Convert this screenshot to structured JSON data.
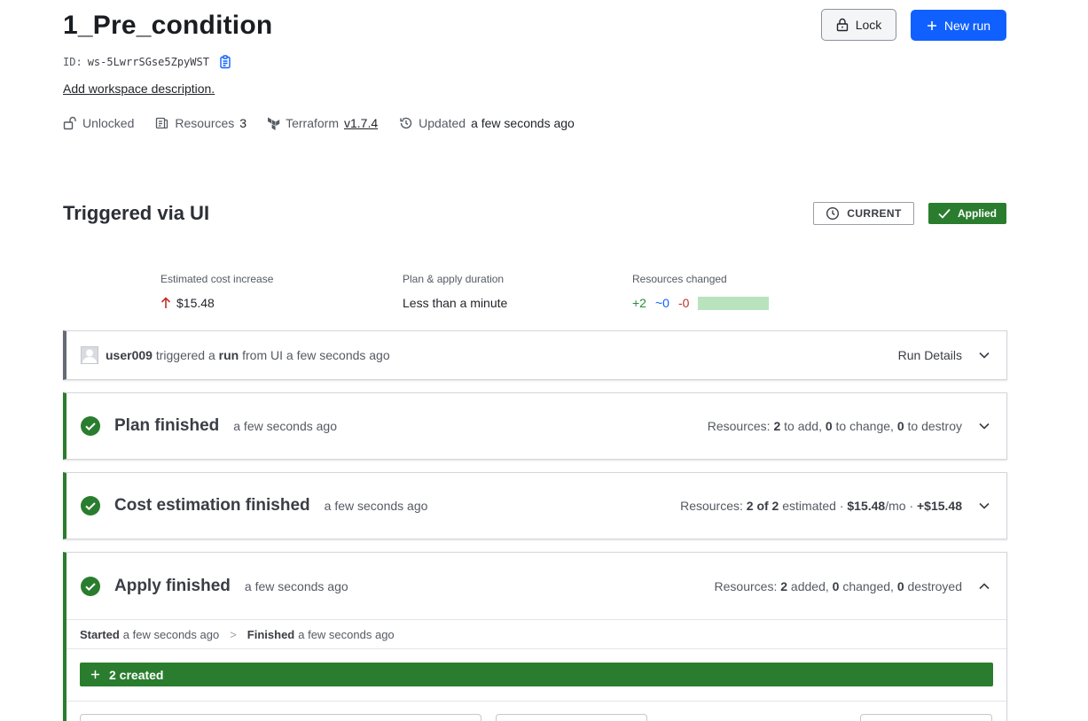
{
  "workspace": {
    "title": "1_Pre_condition",
    "id_label": "ID:",
    "id_value": "ws-5LwrrSGse5ZpyWST",
    "add_description": "Add workspace description."
  },
  "meta": {
    "lock_state": "Unlocked",
    "resources_label": "Resources",
    "resources_count": "3",
    "terraform_label": "Terraform",
    "terraform_version": "v1.7.4",
    "updated_label": "Updated",
    "updated_value": "a few seconds ago"
  },
  "actions": {
    "lock_label": "Lock",
    "new_run_label": "New run"
  },
  "run": {
    "title": "Triggered via UI",
    "current_badge": "CURRENT",
    "status_badge": "Applied"
  },
  "stats": {
    "cost_label": "Estimated cost increase",
    "cost_value": "$15.48",
    "duration_label": "Plan & apply duration",
    "duration_value": "Less than a minute",
    "resources_label": "Resources changed",
    "added": "+2",
    "changed": "~0",
    "destroyed": "-0"
  },
  "trigger": {
    "user": "user009",
    "text1": "triggered a",
    "run_word": "run",
    "text2": "from UI a few seconds ago",
    "details_label": "Run Details"
  },
  "plan": {
    "title": "Plan finished",
    "time": "a few seconds ago",
    "res_prefix": "Resources:",
    "add_count": "2",
    "add_text": "to add,",
    "change_count": "0",
    "change_text": "to change,",
    "destroy_count": "0",
    "destroy_text": "to destroy"
  },
  "cost": {
    "title": "Cost estimation finished",
    "time": "a few seconds ago",
    "res_prefix": "Resources:",
    "estimated_count": "2 of 2",
    "estimated_text": "estimated ·",
    "monthly": "$15.48",
    "monthly_unit": "/mo ·",
    "delta": "+$15.48"
  },
  "apply": {
    "title": "Apply finished",
    "time": "a few seconds ago",
    "res_prefix": "Resources:",
    "added_count": "2",
    "added_text": "added,",
    "changed_count": "0",
    "changed_text": "changed,",
    "destroyed_count": "0",
    "destroyed_text": "destroyed",
    "started_label": "Started",
    "started_value": "a few seconds ago",
    "separator": ">",
    "finished_label": "Finished",
    "finished_value": "a few seconds ago",
    "created_label": "2 created"
  },
  "colors": {
    "primary": "#1060ff",
    "success": "#2a7d2e",
    "added": "#2a8a3a",
    "changed": "#1060ff",
    "destroyed": "#c0302a"
  }
}
